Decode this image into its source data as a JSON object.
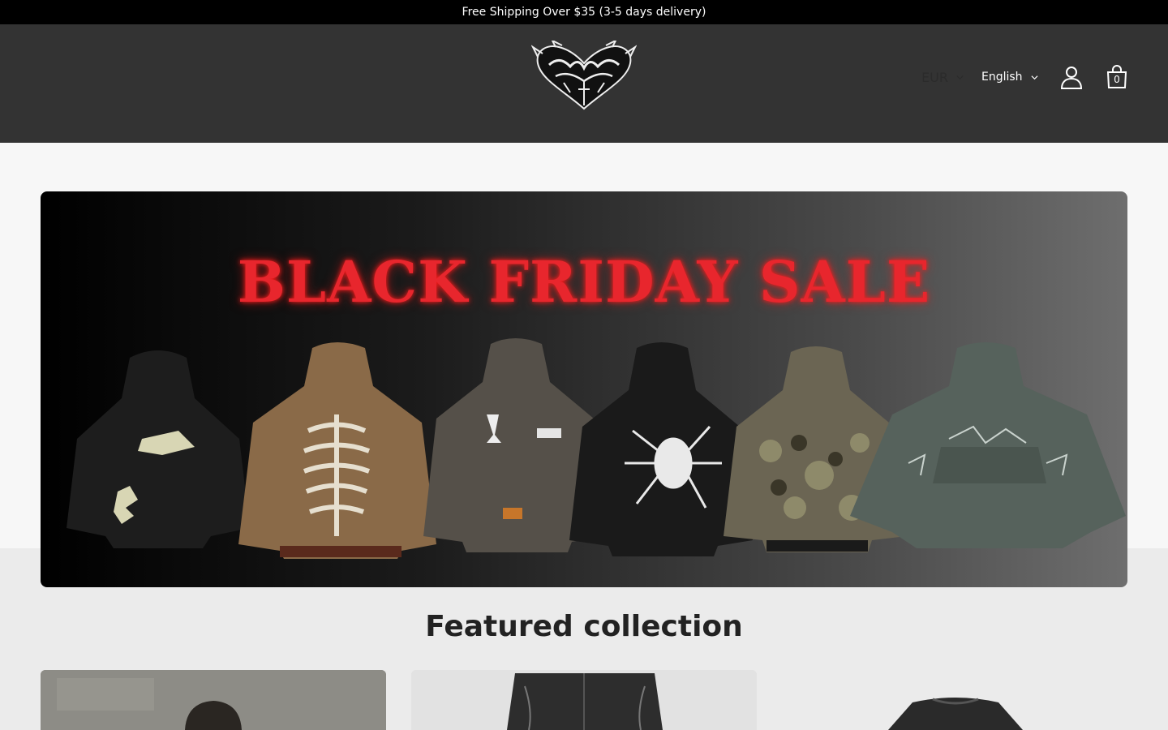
{
  "announcement": {
    "text": "Free Shipping Over $35 (3-5 days delivery)"
  },
  "header": {
    "logo_icon": "gothic-heart-logo",
    "currency_label": "EUR",
    "language_label": "English",
    "account_icon": "user-icon",
    "cart_icon": "shopping-bag-icon",
    "cart_count": "0"
  },
  "hero": {
    "title": "BLACK FRIDAY SALE",
    "title_color": "#e8262d"
  },
  "featured": {
    "title": "Featured collection",
    "products": [
      {
        "icon": "hoodie-product-image"
      },
      {
        "icon": "jeans-product-image"
      },
      {
        "icon": "jacket-product-image"
      }
    ]
  },
  "colors": {
    "announcement_bg": "#000000",
    "header_bg": "#333333",
    "page_bg": "#f7f7f7",
    "section_bg": "#ebebeb"
  }
}
